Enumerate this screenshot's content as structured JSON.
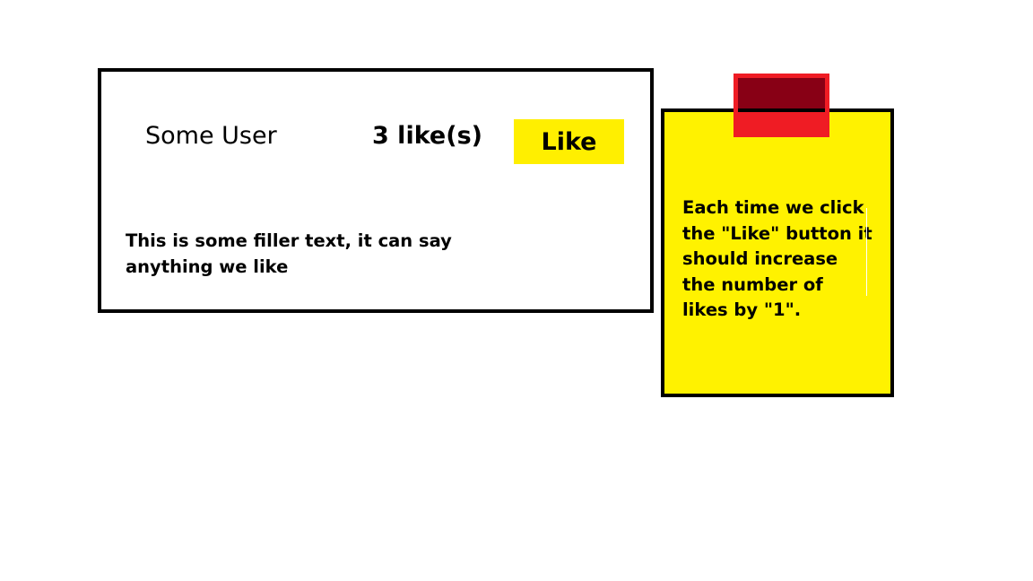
{
  "post": {
    "user_name": "Some User",
    "like_count_text": "3 like(s)",
    "like_button_label": "Like",
    "filler_text": "This is some filler text, it can say anything we like"
  },
  "note": {
    "text": "Each time we click the \"Like\" button it should increase the number of likes by \"1\"."
  },
  "colors": {
    "like_button": "#ffef00",
    "sticky_note": "#fff200",
    "tape_outer": "#ef1c24",
    "tape_inner": "#880015"
  }
}
